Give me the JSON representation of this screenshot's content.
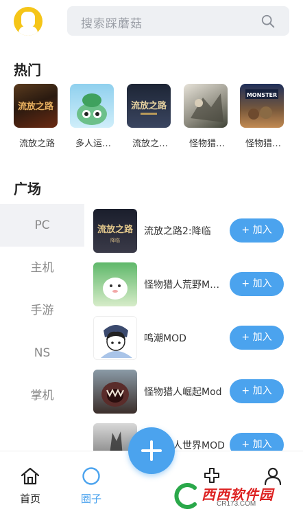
{
  "search": {
    "placeholder": "搜索踩蘑菇"
  },
  "hot": {
    "title": "热门",
    "items": [
      {
        "label": "流放之路"
      },
      {
        "label": "多人运…"
      },
      {
        "label": "流放之…"
      },
      {
        "label": "怪物猎…"
      },
      {
        "label": "怪物猎…"
      }
    ]
  },
  "square": {
    "title": "广场",
    "categories": [
      "PC",
      "主机",
      "手游",
      "NS",
      "掌机"
    ],
    "active_category": "PC",
    "join_label": "+ 加入",
    "games": [
      {
        "name": "流放之路2:降临"
      },
      {
        "name": "怪物猎人荒野M…"
      },
      {
        "name": "鸣潮MOD"
      },
      {
        "name": "怪物猎人崛起Mod"
      },
      {
        "name": "怪物猎人世界MOD"
      }
    ]
  },
  "nav": {
    "items": [
      {
        "label": "首页",
        "icon": "home-icon"
      },
      {
        "label": "圈子",
        "icon": "circle-icon"
      },
      {
        "label": "",
        "icon": "gamepad-icon"
      },
      {
        "label": "",
        "icon": "user-icon"
      }
    ],
    "active": "圈子"
  },
  "colors": {
    "accent": "#4ba3ee",
    "avatar": "#f5c518"
  },
  "watermark": {
    "text": "西西软件园",
    "sub": "CR173.COM"
  }
}
